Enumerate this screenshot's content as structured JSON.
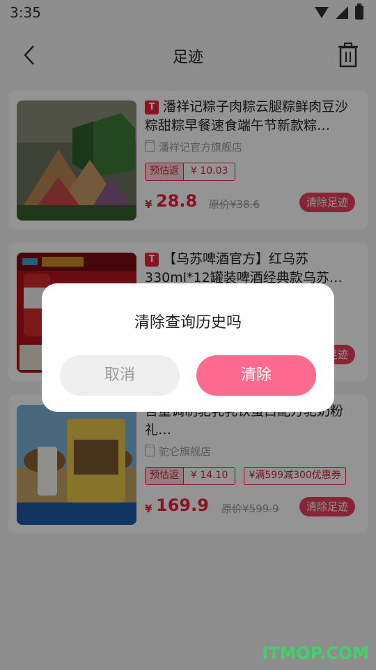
{
  "status_bar": {
    "time": "3:35"
  },
  "header": {
    "title": "足迹",
    "back_icon": "chevron-left-icon",
    "trash_icon": "trash-icon"
  },
  "badge_label": "T",
  "products": [
    {
      "title": "潘祥记粽子肉粽云腿粽鲜肉豆沙粽甜粽早餐速食端午节新款粽…",
      "shop": "潘祥记官方旗舰店",
      "coupon_key": "预估返",
      "coupon_value": "¥ 10.03",
      "voucher": "",
      "price_symbol": "¥",
      "price": "28.8",
      "original_price": "原价¥38.6",
      "clear_label": "清除足迹"
    },
    {
      "title": "【乌苏啤酒官方】红乌苏330ml*12罐装啤酒经典款乌苏…",
      "shop": "",
      "coupon_key": "",
      "coupon_value": "",
      "voucher": "",
      "price_symbol": "",
      "price": "",
      "original_price": "",
      "clear_label": "清除足迹"
    },
    {
      "title": "含量调制驼乳乳铁蛋白配方驼奶粉礼…",
      "shop": "驼仑旗舰店",
      "coupon_key": "预估返",
      "coupon_value": "¥ 14.10",
      "voucher": "¥满599减300优惠券",
      "price_symbol": "¥",
      "price": "169.9",
      "original_price": "原价¥599.9",
      "clear_label": "清除足迹"
    }
  ],
  "dialog": {
    "message": "清除查询历史吗",
    "cancel_label": "取消",
    "confirm_label": "清除"
  },
  "watermark": "ITMOP.COM",
  "colors": {
    "accent": "#e8243c",
    "confirm": "#ff6b8e",
    "overlay": "rgba(0,0,0,0.42)"
  }
}
